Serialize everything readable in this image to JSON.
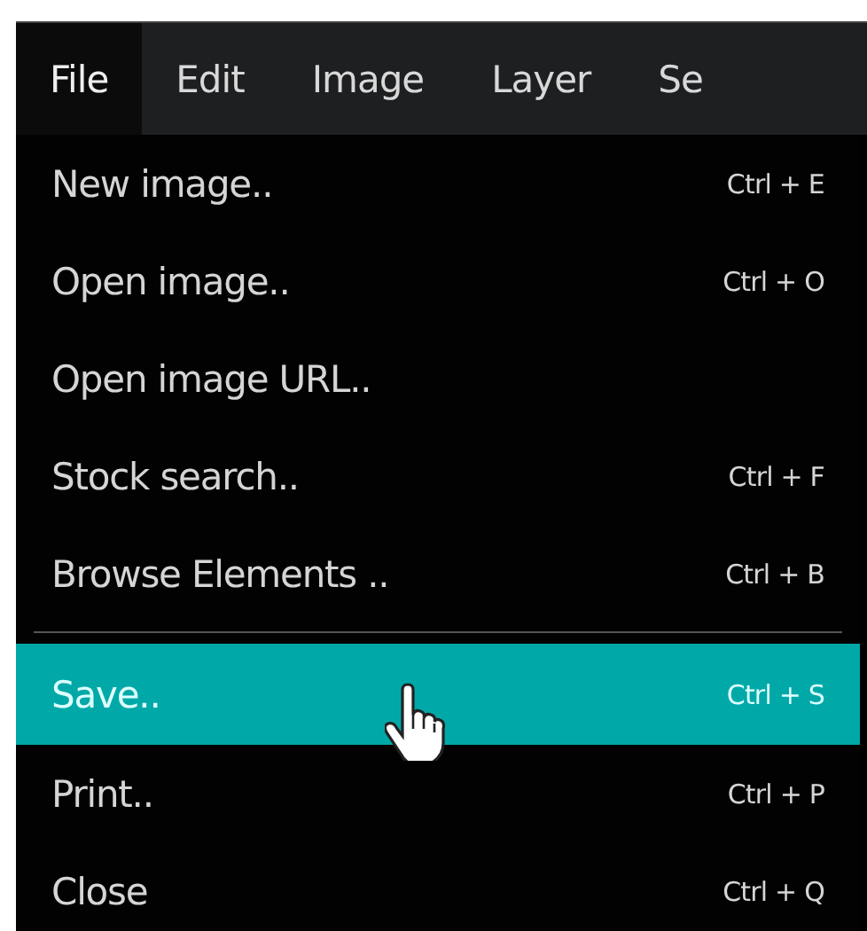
{
  "menubar": [
    {
      "label": "File",
      "selected": true
    },
    {
      "label": "Edit",
      "selected": false
    },
    {
      "label": "Image",
      "selected": false
    },
    {
      "label": "Layer",
      "selected": false
    },
    {
      "label": "Se",
      "selected": false
    }
  ],
  "menu": {
    "groups": [
      [
        {
          "label": "New image..",
          "shortcut": "Ctrl + E",
          "selected": false
        },
        {
          "label": "Open image..",
          "shortcut": "Ctrl + O",
          "selected": false
        },
        {
          "label": "Open image URL..",
          "selected": false
        },
        {
          "label": "Stock search..",
          "shortcut": "Ctrl + F",
          "selected": false
        },
        {
          "label": "Browse Elements ..",
          "shortcut": "Ctrl + B",
          "selected": false
        }
      ],
      [
        {
          "label": "Save..",
          "shortcut": "Ctrl + S",
          "selected": true
        },
        {
          "label": "Print..",
          "shortcut": "Ctrl + P",
          "selected": false
        },
        {
          "label": "Close",
          "shortcut": "Ctrl + Q",
          "selected": false
        }
      ]
    ]
  }
}
